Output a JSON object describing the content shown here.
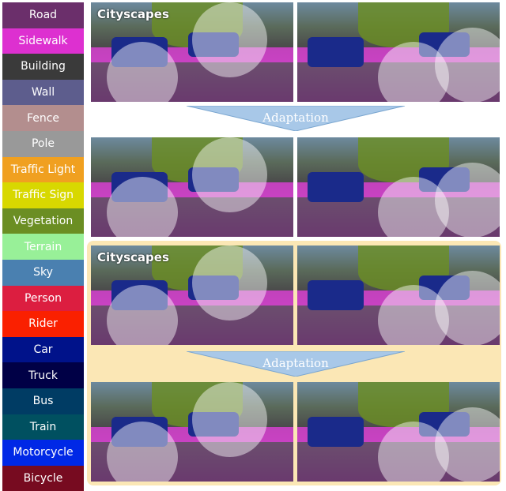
{
  "legend": [
    {
      "label": "Road",
      "color": "#6b2f6b"
    },
    {
      "label": "Sidewalk",
      "color": "#dd30d0"
    },
    {
      "label": "Building",
      "color": "#3a3a3a"
    },
    {
      "label": "Wall",
      "color": "#5d5d8d"
    },
    {
      "label": "Fence",
      "color": "#b38e8e"
    },
    {
      "label": "Pole",
      "color": "#999999"
    },
    {
      "label": "Traffic Light",
      "color": "#f0a020"
    },
    {
      "label": "Traffic Sign",
      "color": "#d8d800"
    },
    {
      "label": "Vegetation",
      "color": "#6b8e23"
    },
    {
      "label": "Terrain",
      "color": "#98f098"
    },
    {
      "label": "Sky",
      "color": "#4a80b0"
    },
    {
      "label": "Person",
      "color": "#dc1e40"
    },
    {
      "label": "Rider",
      "color": "#fa2000"
    },
    {
      "label": "Car",
      "color": "#00128a"
    },
    {
      "label": "Truck",
      "color": "#000046"
    },
    {
      "label": "Bus",
      "color": "#003c64"
    },
    {
      "label": "Train",
      "color": "#005060"
    },
    {
      "label": "Motorcycle",
      "color": "#0028e6"
    },
    {
      "label": "Bicycle",
      "color": "#770b20"
    }
  ],
  "panels": {
    "label": "Cityscapes"
  },
  "arrow": {
    "label": "Adaptation",
    "color": "#a8c8e8"
  },
  "highlight_color": "#fbe7b5"
}
